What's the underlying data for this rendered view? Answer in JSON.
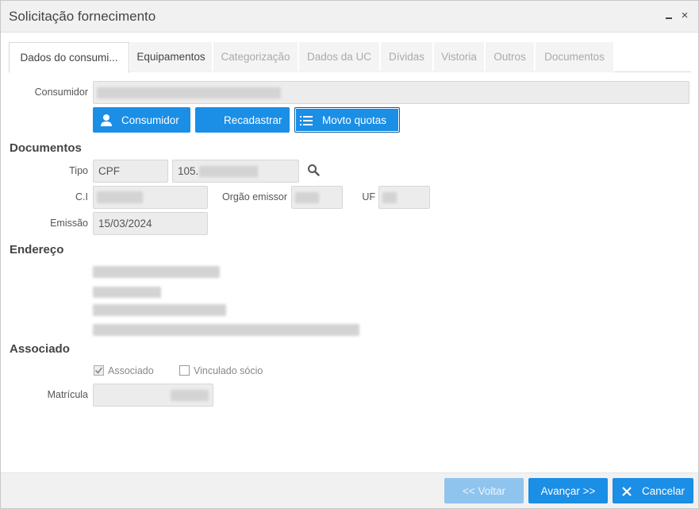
{
  "window": {
    "title": "Solicitação fornecimento",
    "minimize_glyph": "▁",
    "close_glyph": "×"
  },
  "tabs": [
    {
      "label": "Dados do consumi...",
      "active": true
    },
    {
      "label": "Equipamentos",
      "active": false
    },
    {
      "label": "Categorização",
      "active": false
    },
    {
      "label": "Dados da UC",
      "active": false
    },
    {
      "label": "Dívidas",
      "active": false
    },
    {
      "label": "Vistoria",
      "active": false
    },
    {
      "label": "Outros",
      "active": false
    },
    {
      "label": "Documentos",
      "active": false
    }
  ],
  "consumer": {
    "label": "Consumidor",
    "buttons": {
      "consumidor": "Consumidor",
      "recadastrar": "Recadastrar",
      "movto_quotas": "Movto quotas"
    }
  },
  "documentos": {
    "heading": "Documentos",
    "tipo_label": "Tipo",
    "tipo_value": "CPF",
    "doc_prefix": "105.",
    "ci_label": "C.I",
    "orgao_label": "Orgão emissor",
    "uf_label": "UF",
    "emissao_label": "Emissão",
    "emissao_value": "15/03/2024"
  },
  "endereco": {
    "heading": "Endereço"
  },
  "associado": {
    "heading": "Associado",
    "associado_label": "Associado",
    "associado_checked": true,
    "vinculado_label": "Vinculado sócio",
    "vinculado_checked": false,
    "matricula_label": "Matrícula"
  },
  "footer": {
    "voltar": "<< Voltar",
    "avancar": "Avançar >>",
    "cancelar": "Cancelar"
  },
  "colors": {
    "primary": "#1b8ee6",
    "primary_disabled": "#8fc4ee",
    "field_bg": "#ececec"
  }
}
